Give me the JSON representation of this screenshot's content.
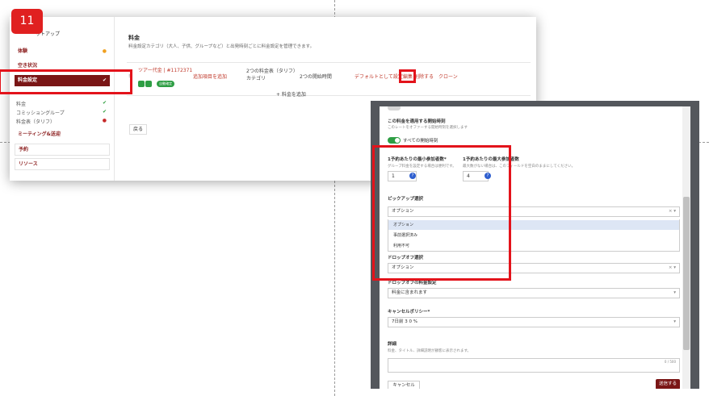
{
  "step_number": "11",
  "sidebar": {
    "title": "ットアップ",
    "items": [
      {
        "label": "体験",
        "status": "●"
      },
      {
        "label": "空き状況",
        "status": ""
      },
      {
        "label": "料金設定",
        "status": "✔"
      }
    ],
    "subitems": [
      {
        "label": "料金",
        "status": "✔"
      },
      {
        "label": "コミッショングループ",
        "status": "✔"
      },
      {
        "label": "料金表（タリフ）",
        "status": "●"
      }
    ],
    "meeting": "ミーティング&送迎",
    "reservations": "予約",
    "resources": "リソース"
  },
  "main": {
    "title": "料金",
    "description": "料金設定カテゴリ（大人、子供、グループなど）と出発時刻ごとに料金設定を管理できます。",
    "rate_row": {
      "name": "ツアー代金 | #1172371",
      "badge": "自動確定",
      "add_extra": "追加項目を追加",
      "tariff": "2つの料金表（タリフ）カテゴリ",
      "start_times": "2つの開始時間",
      "set_default": "デフォルトとして設定",
      "edit": "編集",
      "delete": "削除する",
      "clone": "クローン"
    },
    "add_rate": "+ 料金を追加",
    "back_button": "戻る"
  },
  "modal": {
    "applies_label": "この料金を適用する開始時刻",
    "applies_help": "このレートをオファーする開始時刻を選択します",
    "all_start_times": "すべての開始時刻",
    "min_label": "1予約あたりの最小参加者数*",
    "min_help": "グループ料金を設定する場合は便利です。",
    "min_value": "1",
    "max_label": "1予約あたりの最大参加者数",
    "max_help": "最大数がない場合は、このフィールドを空白のままにしてください。",
    "max_value": "4",
    "help_glyph": "?",
    "pickup_label": "ピックアップ選択",
    "pickup_value": "オプション",
    "pickup_options": [
      "オプション",
      "事前選択済み",
      "利用不可"
    ],
    "dropoff_label": "ドロップオフ選択",
    "dropoff_value": "オプション",
    "dropoff_price_label": "ドロップオフの料金設定",
    "dropoff_price_value": "料金に含まれます",
    "cancel_policy_label": "キャンセルポリシー*",
    "cancel_policy_value": "7日前 3 0 %",
    "details_label": "詳細",
    "details_help": "料金、タイトル、詳細説明が顧客に表示されます。",
    "details_counter": "0 / 500",
    "cancel_button": "キャンセル",
    "submit_button": "送信する",
    "select_controls": "× ▾",
    "select_arrow": "▾"
  },
  "colors": {
    "accent": "#7a1616",
    "highlight": "#e3131b",
    "link": "#c0392b",
    "success": "#2e9e44"
  }
}
